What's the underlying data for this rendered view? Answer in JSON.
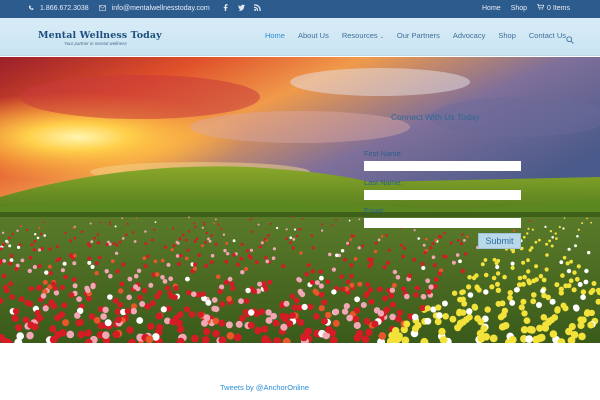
{
  "topbar": {
    "phone": "1.866.672.3038",
    "email": "info@mentalwellnesstoday.com",
    "social_icons": [
      "facebook-icon",
      "twitter-icon",
      "rss-icon"
    ],
    "links": [
      "Home",
      "Shop"
    ],
    "cart_label": "0 Items"
  },
  "logo": {
    "title": "Mental Wellness Today",
    "tagline": "Your partner in mental wellness"
  },
  "nav": {
    "items": [
      "Home",
      "About Us",
      "Resources",
      "Our Partners",
      "Advocacy",
      "Shop",
      "Contact Us"
    ],
    "active": "Home"
  },
  "form": {
    "heading": "Connect With Us Today",
    "first_name_label": "First Name:",
    "first_name_value": "",
    "last_name_label": "Last Name:",
    "last_name_value": "",
    "email_label": "Email:",
    "email_value": "",
    "submit_label": "Submit"
  },
  "footer": {
    "tweets_link": "Tweets by @AnchorOnline"
  },
  "colors": {
    "topbar_bg": "#2c5b8e",
    "header_bg": "#d2e8f5",
    "accent": "#2a8fd8"
  }
}
